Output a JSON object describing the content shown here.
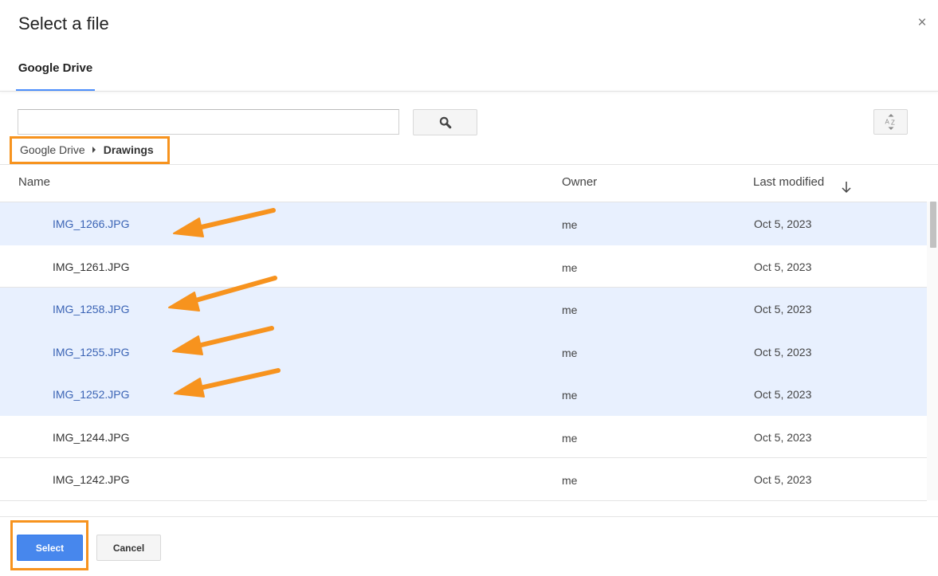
{
  "dialog": {
    "title": "Select a file",
    "close_glyph": "×"
  },
  "tabs": [
    {
      "label": "Google Drive",
      "active": true
    }
  ],
  "search": {
    "value": "",
    "placeholder": ""
  },
  "breadcrumb": {
    "root": "Google Drive",
    "current": "Drawings"
  },
  "columns": {
    "name": "Name",
    "owner": "Owner",
    "last_modified": "Last modified",
    "sort": "descending"
  },
  "files": [
    {
      "name": "IMG_1266.JPG",
      "owner": "me",
      "modified": "Oct 5, 2023",
      "selected": true
    },
    {
      "name": "IMG_1261.JPG",
      "owner": "me",
      "modified": "Oct 5, 2023",
      "selected": false
    },
    {
      "name": "IMG_1258.JPG",
      "owner": "me",
      "modified": "Oct 5, 2023",
      "selected": true
    },
    {
      "name": "IMG_1255.JPG",
      "owner": "me",
      "modified": "Oct 5, 2023",
      "selected": true
    },
    {
      "name": "IMG_1252.JPG",
      "owner": "me",
      "modified": "Oct 5, 2023",
      "selected": true
    },
    {
      "name": "IMG_1244.JPG",
      "owner": "me",
      "modified": "Oct 5, 2023",
      "selected": false
    },
    {
      "name": "IMG_1242.JPG",
      "owner": "me",
      "modified": "Oct 5, 2023",
      "selected": false
    }
  ],
  "footer": {
    "select_label": "Select",
    "cancel_label": "Cancel"
  },
  "icons": {
    "search": "search-icon",
    "sort": "sort-az-icon",
    "sort_direction": "arrow-down-icon",
    "breadcrumb_separator": "caret-right-icon",
    "annotation": "orange-arrow-icon"
  },
  "colors": {
    "accent": "#4d90fe",
    "selected_row": "#e8f0fe",
    "selected_text": "#3b64b5",
    "primary_button": "#4787ed",
    "annotation": "#f7931e"
  }
}
